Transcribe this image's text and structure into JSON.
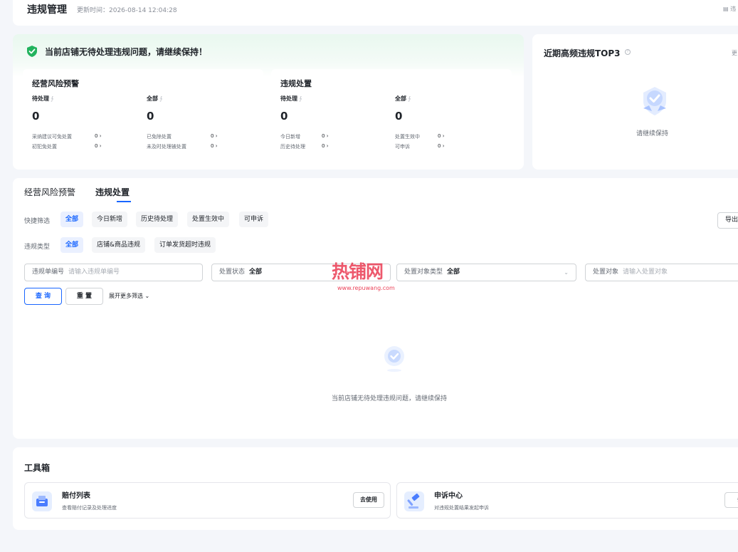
{
  "header": {
    "title": "违规管理",
    "updated": "更新时间：2026-08-14 12:04:28",
    "rules_link": "违"
  },
  "overview": {
    "banner": "当前店铺无待处理违规问题，请继续保持！",
    "risk": {
      "title": "经营风险预警",
      "pending_label": "待处理",
      "pending_value": "0",
      "all_label": "全部",
      "all_value": "0",
      "rows": [
        {
          "label": "采纳建议可免处置",
          "value": "0"
        },
        {
          "label": "初犯免处置",
          "value": "0"
        },
        {
          "label": "已免除处置",
          "value": "0"
        },
        {
          "label": "未及时处理被处置",
          "value": "0"
        }
      ]
    },
    "violation": {
      "title": "违规处置",
      "pending_label": "待处理",
      "pending_value": "0",
      "all_label": "全部",
      "all_value": "0",
      "rows": [
        {
          "label": "今日新增",
          "value": "0"
        },
        {
          "label": "历史待处理",
          "value": "0"
        },
        {
          "label": "处置生效中",
          "value": "0"
        },
        {
          "label": "可申诉",
          "value": "0"
        }
      ]
    }
  },
  "top3": {
    "title": "近期高频违规TOP3",
    "more": "更",
    "empty": "请继续保持"
  },
  "main": {
    "tabs": [
      "经营风险预警",
      "违规处置"
    ],
    "active_tab": "违规处置",
    "quick_filter_label": "快捷筛选",
    "quick_filters": [
      "全部",
      "今日新增",
      "历史待处理",
      "处置生效中",
      "可申诉"
    ],
    "type_label": "违规类型",
    "types": [
      "全部",
      "店铺&商品违规",
      "订单发货超时违规"
    ],
    "export_label": "导出",
    "fields": {
      "order_no_label": "违规单编号",
      "order_no_placeholder": "请输入违规单编号",
      "status_label": "处置状态",
      "status_value": "全部",
      "target_type_label": "处置对象类型",
      "target_type_value": "全部",
      "target_label": "处置对象",
      "target_placeholder": "请输入处置对象"
    },
    "query_label": "查 询",
    "reset_label": "重 置",
    "expand_label": "展开更多筛选",
    "empty_text": "当前店铺无待处理违规问题，请继续保持"
  },
  "watermark": {
    "text": "热铺网",
    "url": "www.repuwang.com"
  },
  "toolbox": {
    "title": "工具箱",
    "tools": [
      {
        "name": "赔付列表",
        "desc": "查看赔付记录及处理进度",
        "button": "去使用"
      },
      {
        "name": "申诉中心",
        "desc": "对违规处置结果发起申诉",
        "button": "去"
      }
    ]
  },
  "colors": {
    "accent": "#1966ff",
    "success": "#22b35e",
    "page_bg": "#f4f6fa"
  }
}
